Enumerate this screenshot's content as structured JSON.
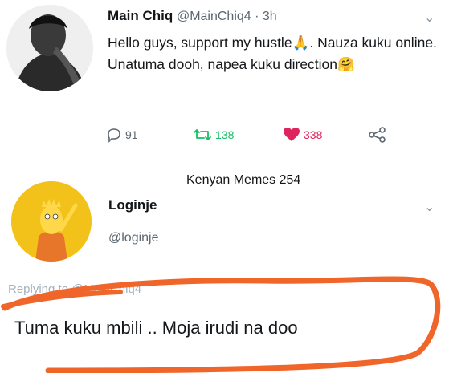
{
  "tweet1": {
    "name": "Main Chiq",
    "handle_time": "@MainChiq4 · 3h",
    "text": "Hello guys, support my hustle🙏. Nauza kuku online. Unatuma dooh, napea kuku direction🤗",
    "reply_count": "91",
    "retweet_count": "138",
    "like_count": "338",
    "chevron": "⌄"
  },
  "watermark": "Kenyan Memes 254",
  "tweet2": {
    "name": "Loginje",
    "handle": "@loginje",
    "replying": "Replying to @MainChiq4",
    "text": "Tuma kuku mbili .. Moja irudi na doo",
    "chevron": "⌄"
  },
  "colors": {
    "retweet": "#17bf63",
    "like": "#e0245e",
    "annotation": "#f0652a"
  },
  "icons": [
    "reply-icon",
    "retweet-icon",
    "heart-icon",
    "share-icon",
    "chevron-down-icon"
  ]
}
